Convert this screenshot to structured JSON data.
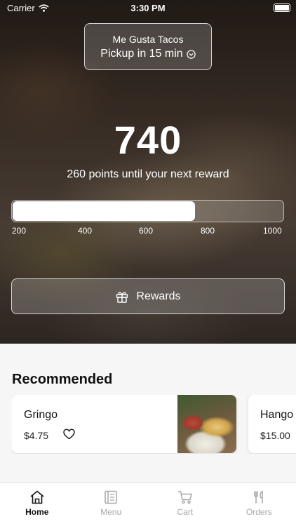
{
  "status_bar": {
    "carrier": "Carrier",
    "time": "3:30 PM"
  },
  "store": {
    "name": "Me Gusta Tacos",
    "pickup": "Pickup in 15 min"
  },
  "points": {
    "value": "740",
    "caption": "260 points until your next reward",
    "progress_min": 200,
    "progress_max": 1000,
    "progress_value": 740,
    "ticks": [
      "200",
      "400",
      "600",
      "800",
      "1000"
    ]
  },
  "rewards_button": {
    "label": "Rewards"
  },
  "recommended": {
    "title": "Recommended",
    "items": [
      {
        "name": "Gringo",
        "price": "$4.75"
      },
      {
        "name": "Hango",
        "price": "$15.00"
      }
    ]
  },
  "tabs": [
    {
      "label": "Home",
      "icon": "home-icon",
      "active": true
    },
    {
      "label": "Menu",
      "icon": "menu-icon",
      "active": false
    },
    {
      "label": "Cart",
      "icon": "cart-icon",
      "active": false
    },
    {
      "label": "Orders",
      "icon": "utensils-icon",
      "active": false
    }
  ],
  "colors": {
    "active_tab": "#111111",
    "inactive_tab": "#a7a7a7",
    "progress_fill": "#ffffff"
  }
}
